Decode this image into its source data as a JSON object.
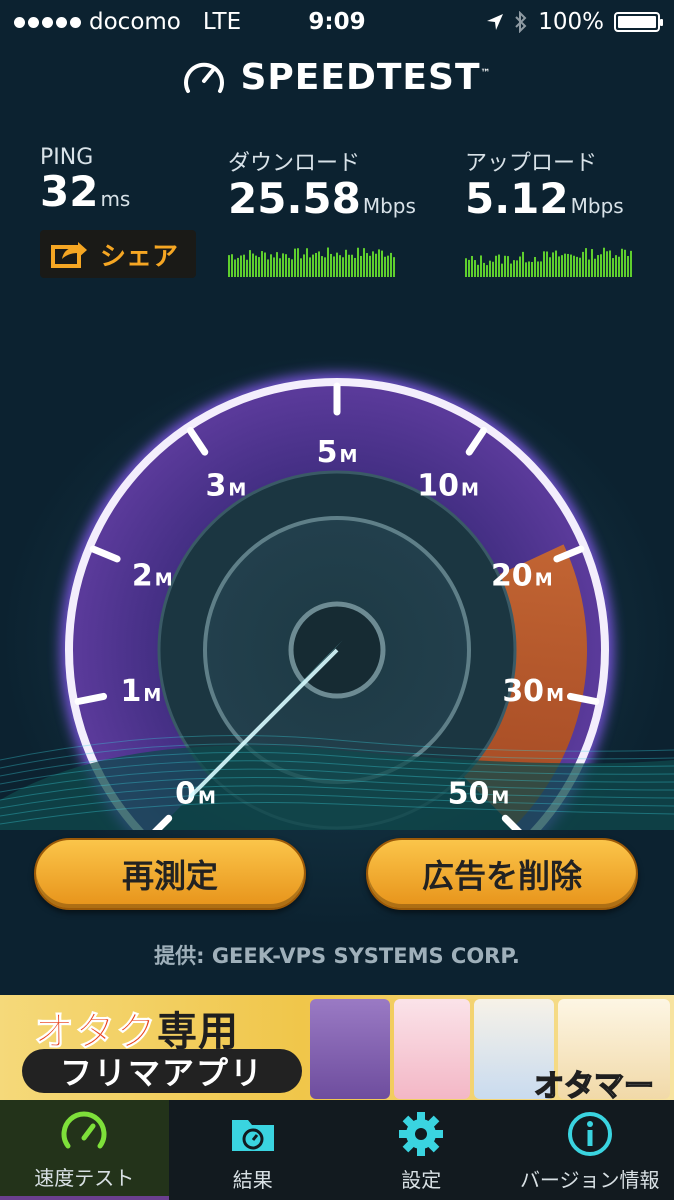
{
  "status_bar": {
    "carrier": "docomo",
    "network": "LTE",
    "time": "9:09",
    "battery": "100%",
    "icons": [
      "signal-dots-icon",
      "location-arrow-icon",
      "bluetooth-icon",
      "battery-icon"
    ]
  },
  "header": {
    "title": "SPEEDTEST",
    "trademark": "™"
  },
  "stats": {
    "ping": {
      "label": "PING",
      "value": "32",
      "unit": "ms"
    },
    "download": {
      "label": "ダウンロード",
      "value": "25.58",
      "unit": "Mbps"
    },
    "upload": {
      "label": "アップロード",
      "value": "5.12",
      "unit": "Mbps"
    }
  },
  "share": {
    "label": "シェア"
  },
  "gauge": {
    "tick_labels": [
      {
        "num": "0",
        "unit": "M"
      },
      {
        "num": "1",
        "unit": "M"
      },
      {
        "num": "2",
        "unit": "M"
      },
      {
        "num": "3",
        "unit": "M"
      },
      {
        "num": "5",
        "unit": "M"
      },
      {
        "num": "10",
        "unit": "M"
      },
      {
        "num": "20",
        "unit": "M"
      },
      {
        "num": "30",
        "unit": "M"
      },
      {
        "num": "50",
        "unit": "M"
      }
    ],
    "needle_fraction": 0.0,
    "colors": {
      "accent": "#8b5cf6",
      "highlight": "#f08a3c",
      "needle": "#7ee7f0"
    }
  },
  "buttons": {
    "retest": "再測定",
    "remove_ads": "広告を削除"
  },
  "provider": "提供: GEEK-VPS SYSTEMS CORP.",
  "ad": {
    "title_kana": "オタク",
    "title_kanji": "専用",
    "subtitle": "フリマアプリ",
    "brand": "オタマート"
  },
  "tabs": [
    {
      "label": "速度テスト",
      "icon": "gauge-icon",
      "active": true
    },
    {
      "label": "結果",
      "icon": "results-folder-icon",
      "active": false
    },
    {
      "label": "設定",
      "icon": "gear-icon",
      "active": false
    },
    {
      "label": "バージョン情報",
      "icon": "info-icon",
      "active": false
    }
  ],
  "colors": {
    "background": "#0c2230",
    "orange": "#f5a623",
    "cyan": "#3ad4e0",
    "green": "#7ee03a"
  }
}
